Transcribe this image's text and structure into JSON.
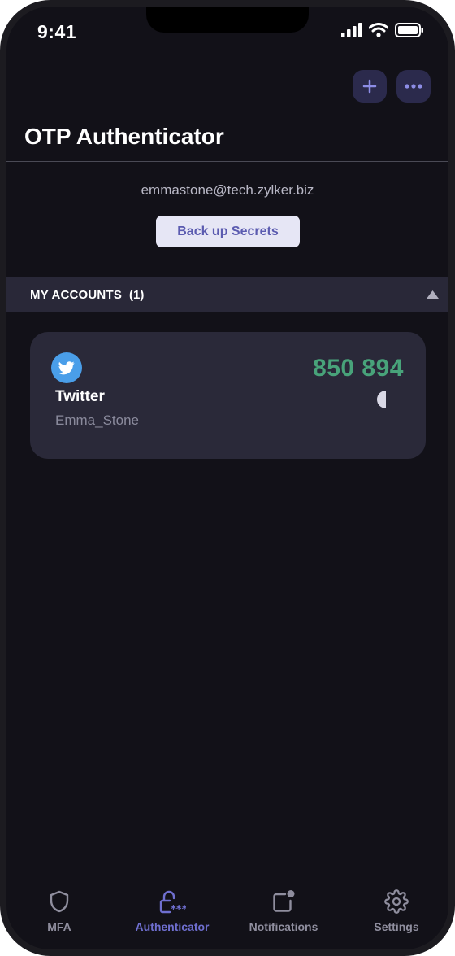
{
  "status_bar": {
    "time": "9:41"
  },
  "header": {
    "title": "OTP Authenticator",
    "add_icon": "plus-icon",
    "more_icon": "more-horizontal-icon"
  },
  "account": {
    "email": "emmastone@tech.zylker.biz",
    "backup_label": "Back up Secrets"
  },
  "section": {
    "label": "MY ACCOUNTS",
    "count": "(1)",
    "expanded": true
  },
  "accounts": [
    {
      "service": "Twitter",
      "username": "Emma_Stone",
      "code": "850 894",
      "icon": "twitter-icon",
      "timer_remaining_fraction": 0.5
    }
  ],
  "tabs": [
    {
      "label": "MFA",
      "icon": "shield-icon",
      "active": false
    },
    {
      "label": "Authenticator",
      "icon": "lock-icon",
      "active": true
    },
    {
      "label": "Notifications",
      "icon": "notification-icon",
      "active": false
    },
    {
      "label": "Settings",
      "icon": "gear-icon",
      "active": false
    }
  ],
  "colors": {
    "background": "#121118",
    "accent": "#6f6fd0",
    "otp_code": "#48a37a",
    "card": "#2a2939",
    "twitter": "#4a9ee9"
  }
}
